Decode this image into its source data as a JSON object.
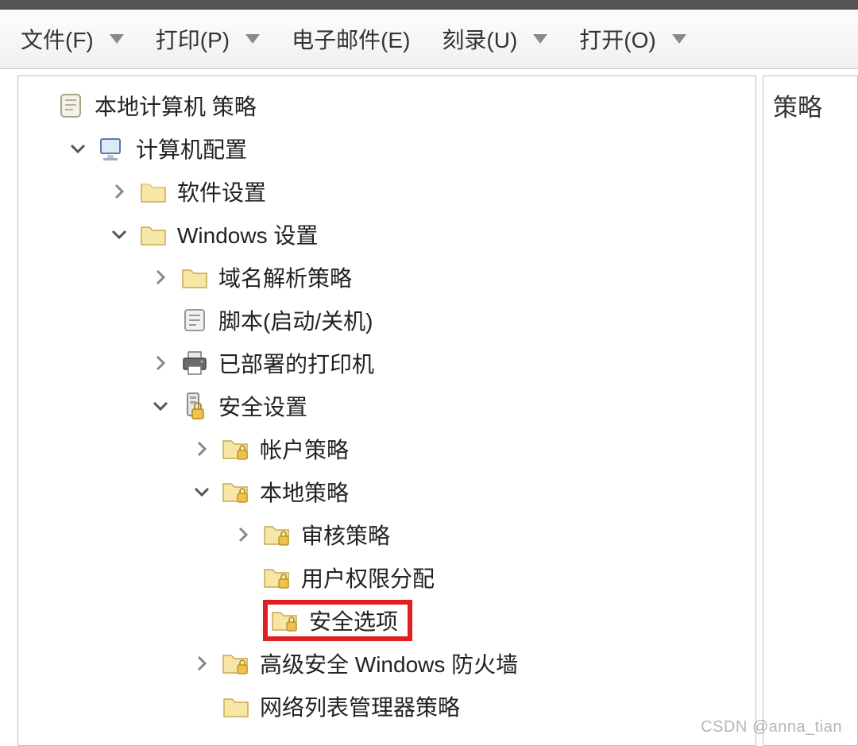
{
  "toolbar": {
    "file": "文件(F)",
    "print": "打印(P)",
    "email": "电子邮件(E)",
    "burn": "刻录(U)",
    "open": "打开(O)"
  },
  "right": {
    "header": "策略"
  },
  "tree": {
    "root": "本地计算机 策略",
    "computer_config": "计算机配置",
    "software_settings": "软件设置",
    "windows_settings": "Windows 设置",
    "dns_policy": "域名解析策略",
    "scripts": "脚本(启动/关机)",
    "deployed_printers": "已部署的打印机",
    "security_settings": "安全设置",
    "account_policies": "帐户策略",
    "local_policies": "本地策略",
    "audit_policy": "审核策略",
    "user_rights": "用户权限分配",
    "security_options": "安全选项",
    "firewall": "高级安全 Windows 防火墙",
    "network_list": "网络列表管理器策略"
  },
  "watermark": "CSDN @anna_tian"
}
